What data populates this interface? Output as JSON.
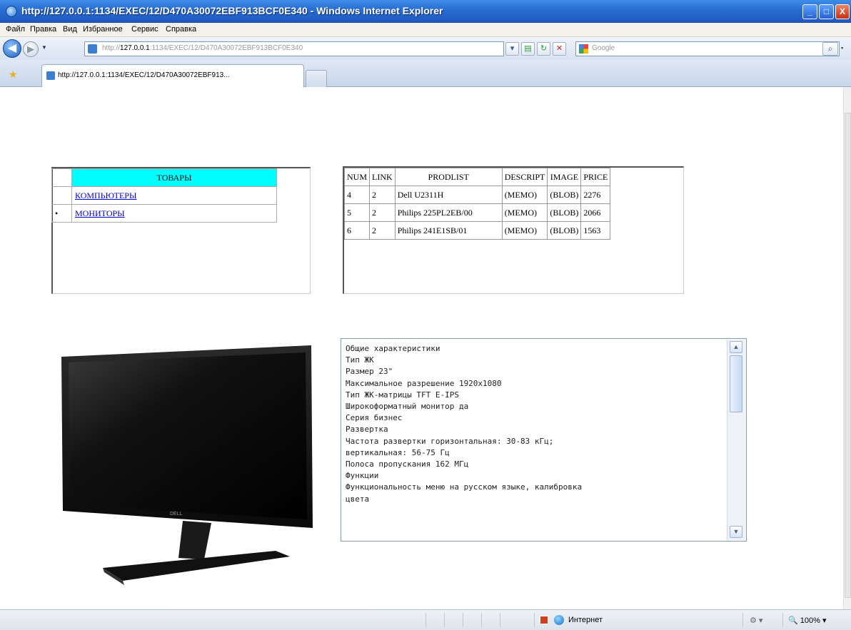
{
  "window": {
    "title": "http://127.0.0.1:1134/EXEC/12/D470A30072EBF913BCF0E340 - Windows Internet Explorer",
    "min": "_",
    "max": "□",
    "close": "X"
  },
  "menu": [
    "Файл",
    "Правка",
    "Вид",
    "Избранное",
    "Сервис",
    "Справка"
  ],
  "address": {
    "prefix": "http://",
    "host": "127.0.0.1",
    "path": ":1134/EXEC/12/D470A30072EBF913BCF0E340",
    "search_placeholder": "Google"
  },
  "tab": {
    "label": "http://127.0.0.1:1134/EXEC/12/D470A30072EBF913..."
  },
  "categories": {
    "header": "ТОВАРЫ",
    "items": [
      {
        "label": "КОМПЬЮТЕРЫ",
        "marker": ""
      },
      {
        "label": "МОНИТОРЫ",
        "marker": "•"
      }
    ]
  },
  "products": {
    "columns": [
      "NUM",
      "LINK",
      "PRODLIST",
      "DESCRIPT",
      "IMAGE",
      "PRICE"
    ],
    "rows": [
      [
        "4",
        "2",
        "Dell U2311H",
        "(MEMO)",
        "(BLOB)",
        "2276"
      ],
      [
        "5",
        "2",
        "Philips 225PL2EB/00",
        "(MEMO)",
        "(BLOB)",
        "2066"
      ],
      [
        "6",
        "2",
        "Philips 241E1SB/01",
        "(MEMO)",
        "(BLOB)",
        "1563"
      ]
    ]
  },
  "monitor_brand": "DELL",
  "memo": "Общие характеристики\nТип ЖК\nРазмер 23\"\nМаксимальное разрешение 1920x1080\nТип ЖК-матрицы TFT E-IPS\nШирокоформатный монитор да\nСерия бизнес\nРазвертка\nЧастота развертки горизонтальная: 30-83 кГц;\nвертикальная: 56-75 Гц\nПолоса пропускания 162 МГц\nФункции\nФункциональность меню на русском языке, калибровка\nцвета",
  "status": {
    "zone": "Интернет",
    "zoom": "100%"
  }
}
